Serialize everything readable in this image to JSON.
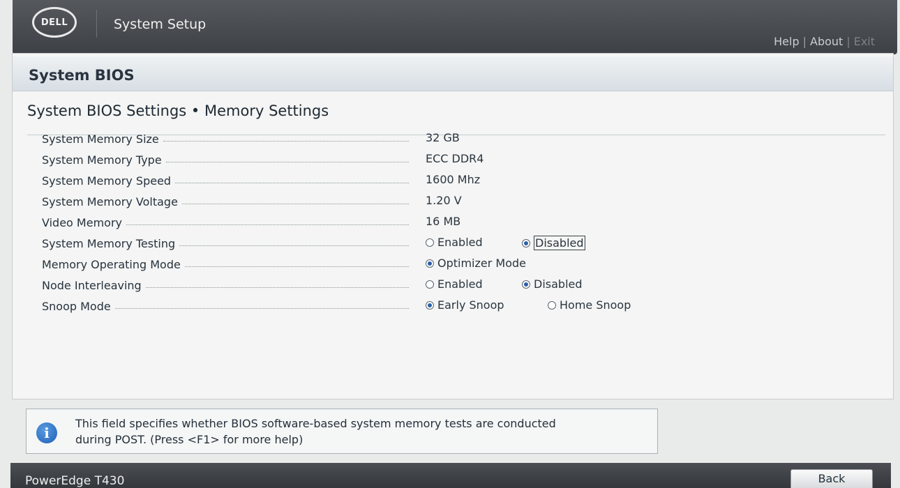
{
  "header": {
    "logo_text": "DELL",
    "title": "System Setup",
    "links": [
      "Help",
      "About",
      "Exit"
    ],
    "separator": "|"
  },
  "section": {
    "title": "System BIOS"
  },
  "page": {
    "title": "System BIOS Settings • Memory Settings"
  },
  "settings": [
    {
      "label": "System Memory Size",
      "value": "32 GB"
    },
    {
      "label": "System Memory Type",
      "value": "ECC DDR4"
    },
    {
      "label": "System Memory Speed",
      "value": "1600 Mhz"
    },
    {
      "label": "System Memory Voltage",
      "value": "1.20 V"
    },
    {
      "label": "Video Memory",
      "value": "16 MB"
    },
    {
      "label": "System Memory Testing",
      "options": [
        {
          "label": "Enabled",
          "selected": false
        },
        {
          "label": "Disabled",
          "selected": true
        }
      ]
    },
    {
      "label": "Memory Operating Mode",
      "options": [
        {
          "label": "Optimizer Mode",
          "selected": true
        }
      ]
    },
    {
      "label": "Node Interleaving",
      "options": [
        {
          "label": "Enabled",
          "selected": false
        },
        {
          "label": "Disabled",
          "selected": true
        }
      ]
    },
    {
      "label": "Snoop Mode",
      "options": [
        {
          "label": "Early Snoop",
          "selected": true
        },
        {
          "label": "Home Snoop",
          "selected": false
        }
      ]
    }
  ],
  "help": {
    "icon": "info-icon",
    "line1": "This field specifies whether BIOS software-based system memory tests are conducted",
    "line2": "during POST. (Press <F1> for more help)"
  },
  "footer": {
    "model": "PowerEdge T430",
    "back_label": "Back"
  },
  "colors": {
    "header_bg": "#45494e",
    "accent_radio": "#2b5fa8",
    "info_icon": "#1c5fb8"
  }
}
